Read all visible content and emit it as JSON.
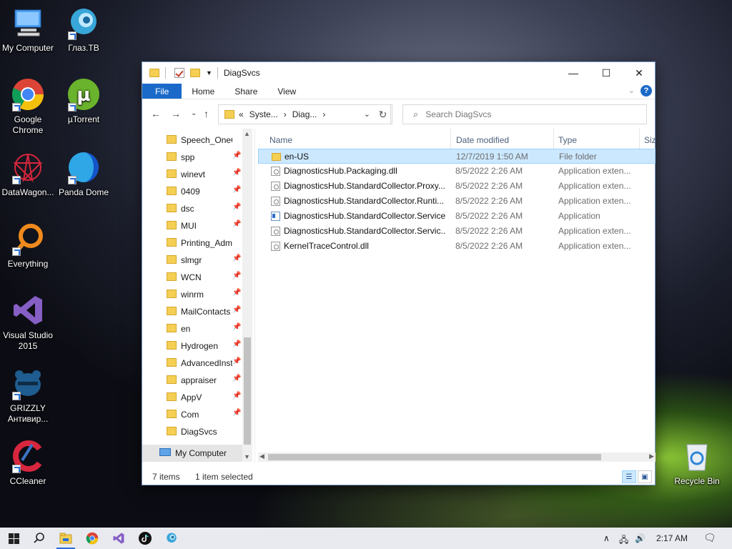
{
  "desktop": {
    "icons": [
      {
        "label": "My Computer",
        "icon": "computer-icon"
      },
      {
        "label": "Глаз.ТВ",
        "icon": "glaz-tv-icon"
      },
      {
        "label": "Google Chrome",
        "icon": "chrome-icon"
      },
      {
        "label": "µTorrent",
        "icon": "utorrent-icon"
      },
      {
        "label": "DataWagon...",
        "icon": "datawagon-icon"
      },
      {
        "label": "Panda Dome",
        "icon": "panda-dome-icon"
      },
      {
        "label": "Everything",
        "icon": "everything-icon"
      },
      {
        "label": "Visual Studio 2015",
        "icon": "visual-studio-icon"
      },
      {
        "label": "GRIZZLY Антивир...",
        "icon": "grizzly-icon"
      },
      {
        "label": "CCleaner",
        "icon": "ccleaner-icon"
      },
      {
        "label": "Recycle Bin",
        "icon": "recycle-bin-icon"
      }
    ]
  },
  "window": {
    "title": "DiagSvcs",
    "controls": {
      "minimize": "—",
      "maximize": "☐",
      "close": "✕"
    },
    "ribbon": {
      "tabs": [
        "File",
        "Home",
        "Share",
        "View"
      ],
      "help": "?"
    },
    "address": {
      "prefix": "«",
      "segments": [
        "Syste...",
        "Diag..."
      ],
      "separator": "›"
    },
    "search": {
      "placeholder": "Search DiagSvcs"
    },
    "nav": {
      "items": [
        "Speech_OneC",
        "spp",
        "winevt",
        "0409",
        "dsc",
        "MUI",
        "Printing_Adm",
        "slmgr",
        "WCN",
        "winrm",
        "MailContacts",
        "en",
        "Hydrogen",
        "AdvancedInst",
        "appraiser",
        "AppV",
        "Com",
        "DiagSvcs"
      ],
      "computer": "My Computer"
    },
    "columns": {
      "name": "Name",
      "date": "Date modified",
      "type": "Type",
      "size": "Siz"
    },
    "files": [
      {
        "name": "en-US",
        "date": "12/7/2019 1:50 AM",
        "type": "File folder",
        "kind": "folder",
        "selected": true
      },
      {
        "name": "DiagnosticsHub.Packaging.dll",
        "date": "8/5/2022 2:26 AM",
        "type": "Application exten...",
        "kind": "dll",
        "selected": false
      },
      {
        "name": "DiagnosticsHub.StandardCollector.Proxy...",
        "date": "8/5/2022 2:26 AM",
        "type": "Application exten...",
        "kind": "dll",
        "selected": false
      },
      {
        "name": "DiagnosticsHub.StandardCollector.Runti...",
        "date": "8/5/2022 2:26 AM",
        "type": "Application exten...",
        "kind": "dll",
        "selected": false
      },
      {
        "name": "DiagnosticsHub.StandardCollector.Service",
        "date": "8/5/2022 2:26 AM",
        "type": "Application",
        "kind": "app",
        "selected": false
      },
      {
        "name": "DiagnosticsHub.StandardCollector.Servic...",
        "date": "8/5/2022 2:26 AM",
        "type": "Application exten...",
        "kind": "dll",
        "selected": false
      },
      {
        "name": "KernelTraceControl.dll",
        "date": "8/5/2022 2:26 AM",
        "type": "Application exten...",
        "kind": "dll",
        "selected": false
      }
    ],
    "status": {
      "count": "7 items",
      "selection": "1 item selected"
    }
  },
  "taskbar": {
    "time": "2:17 AM",
    "apps": [
      "start-icon",
      "search-icon",
      "file-explorer-icon",
      "chrome-icon",
      "visual-studio-icon",
      "tiktok-icon",
      "glaz-tv-icon"
    ]
  },
  "colors": {
    "accent": "#1b6ac9",
    "selection": "#cce8ff",
    "folder": "#f4cf54"
  }
}
